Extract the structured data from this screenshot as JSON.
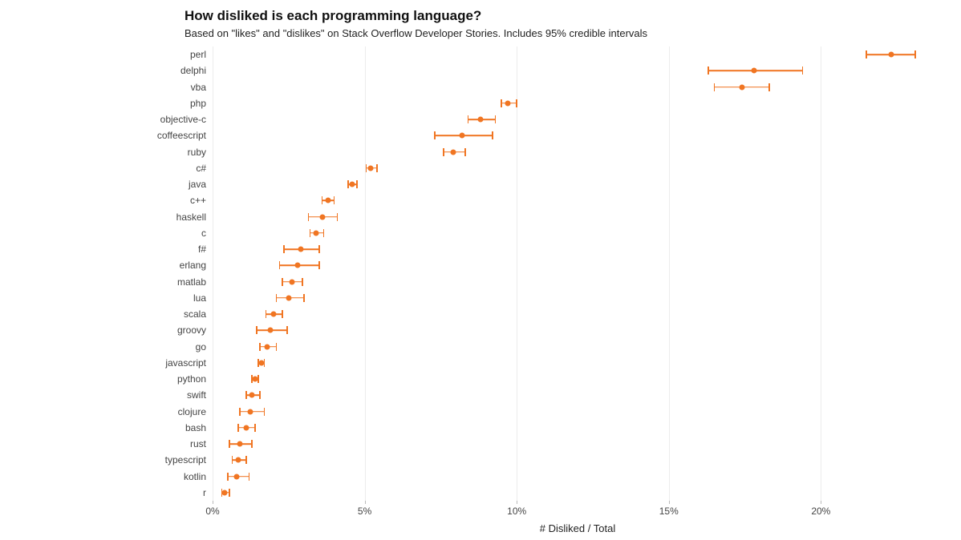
{
  "chart_data": {
    "type": "dot-error",
    "title": "How disliked is each programming language?",
    "subtitle": "Based on \"likes\" and \"dislikes\" on Stack Overflow Developer Stories. Includes 95% credible intervals",
    "xlabel": "# Disliked / Total",
    "ylabel": "",
    "xlim": [
      0,
      24
    ],
    "x_ticks": [
      0,
      5,
      10,
      15,
      20
    ],
    "x_tick_labels": [
      "0%",
      "5%",
      "10%",
      "15%",
      "20%"
    ],
    "color": "#f07522",
    "series": [
      {
        "name": "perl",
        "value": 22.3,
        "low": 21.5,
        "high": 23.1
      },
      {
        "name": "delphi",
        "value": 17.8,
        "low": 16.3,
        "high": 19.4
      },
      {
        "name": "vba",
        "value": 17.4,
        "low": 16.5,
        "high": 18.3
      },
      {
        "name": "php",
        "value": 9.7,
        "low": 9.5,
        "high": 10.0
      },
      {
        "name": "objective-c",
        "value": 8.8,
        "low": 8.4,
        "high": 9.3
      },
      {
        "name": "coffeescript",
        "value": 8.2,
        "low": 7.3,
        "high": 9.2
      },
      {
        "name": "ruby",
        "value": 7.9,
        "low": 7.6,
        "high": 8.3
      },
      {
        "name": "c#",
        "value": 5.2,
        "low": 5.05,
        "high": 5.4
      },
      {
        "name": "java",
        "value": 4.6,
        "low": 4.45,
        "high": 4.75
      },
      {
        "name": "c++",
        "value": 3.8,
        "low": 3.6,
        "high": 4.0
      },
      {
        "name": "haskell",
        "value": 3.6,
        "low": 3.15,
        "high": 4.1
      },
      {
        "name": "c",
        "value": 3.4,
        "low": 3.2,
        "high": 3.65
      },
      {
        "name": "f#",
        "value": 2.9,
        "low": 2.35,
        "high": 3.5
      },
      {
        "name": "erlang",
        "value": 2.8,
        "low": 2.2,
        "high": 3.5
      },
      {
        "name": "matlab",
        "value": 2.6,
        "low": 2.3,
        "high": 2.95
      },
      {
        "name": "lua",
        "value": 2.5,
        "low": 2.1,
        "high": 3.0
      },
      {
        "name": "scala",
        "value": 2.0,
        "low": 1.75,
        "high": 2.3
      },
      {
        "name": "groovy",
        "value": 1.9,
        "low": 1.45,
        "high": 2.45
      },
      {
        "name": "go",
        "value": 1.8,
        "low": 1.55,
        "high": 2.1
      },
      {
        "name": "javascript",
        "value": 1.6,
        "low": 1.5,
        "high": 1.7
      },
      {
        "name": "python",
        "value": 1.4,
        "low": 1.3,
        "high": 1.5
      },
      {
        "name": "swift",
        "value": 1.3,
        "low": 1.1,
        "high": 1.55
      },
      {
        "name": "clojure",
        "value": 1.25,
        "low": 0.9,
        "high": 1.7
      },
      {
        "name": "bash",
        "value": 1.1,
        "low": 0.85,
        "high": 1.4
      },
      {
        "name": "rust",
        "value": 0.9,
        "low": 0.55,
        "high": 1.3
      },
      {
        "name": "typescript",
        "value": 0.85,
        "low": 0.65,
        "high": 1.1
      },
      {
        "name": "kotlin",
        "value": 0.8,
        "low": 0.5,
        "high": 1.2
      },
      {
        "name": "r",
        "value": 0.4,
        "low": 0.3,
        "high": 0.55
      }
    ]
  }
}
